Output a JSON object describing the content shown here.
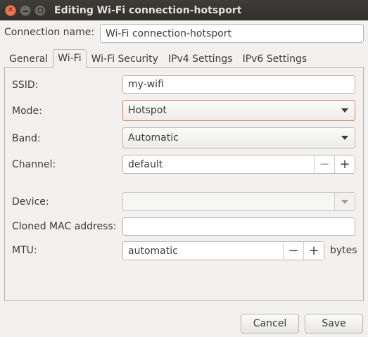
{
  "window": {
    "title": "Editing Wi-Fi connection-hotsport"
  },
  "connection_name": {
    "label": "Connection name:",
    "value": "Wi-Fi connection-hotsport"
  },
  "tabs": [
    {
      "label": "General",
      "active": false
    },
    {
      "label": "Wi-Fi",
      "active": true
    },
    {
      "label": "Wi-Fi Security",
      "active": false
    },
    {
      "label": "IPv4 Settings",
      "active": false
    },
    {
      "label": "IPv6 Settings",
      "active": false
    }
  ],
  "wifi": {
    "ssid": {
      "label": "SSID:",
      "value": "my-wifi"
    },
    "mode": {
      "label": "Mode:",
      "value": "Hotspot"
    },
    "band": {
      "label": "Band:",
      "value": "Automatic"
    },
    "channel": {
      "label": "Channel:",
      "value": "default",
      "minus": "−",
      "plus": "+"
    },
    "device": {
      "label": "Device:",
      "value": ""
    },
    "cloned_mac": {
      "label": "Cloned MAC address:",
      "value": ""
    },
    "mtu": {
      "label": "MTU:",
      "value": "automatic",
      "minus": "−",
      "plus": "+",
      "unit": "bytes"
    }
  },
  "buttons": {
    "cancel": "Cancel",
    "save": "Save"
  },
  "colors": {
    "accent": "#d78467",
    "titlebar": "#302f2c",
    "close_button": "#f0754e"
  }
}
